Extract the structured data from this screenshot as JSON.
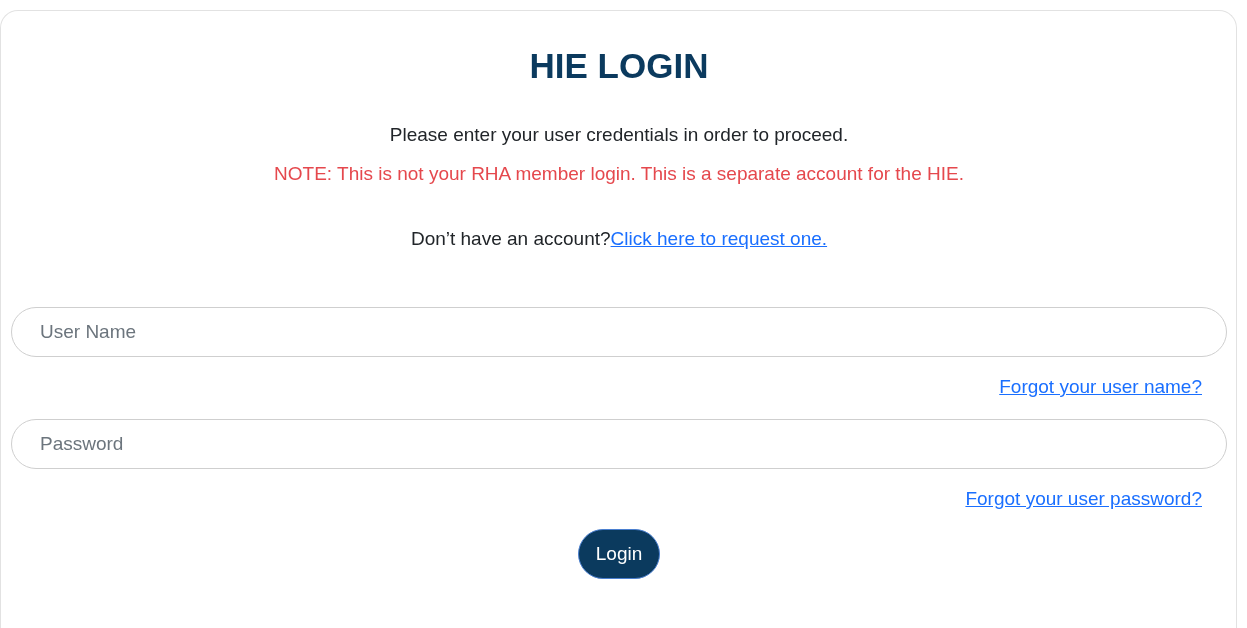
{
  "title": "HIE LOGIN",
  "instructions": "Please enter your user credentials in order to proceed.",
  "note": "NOTE: This is not your RHA member login. This is a separate account for the HIE.",
  "signup": {
    "prompt": "Don’t have an account?",
    "link": "Click here to request one."
  },
  "fields": [
    {
      "placeholder": "User Name",
      "help_link": "Forgot your user name?"
    },
    {
      "placeholder": "Password",
      "help_link": "Forgot your user password?"
    }
  ],
  "login_button": "Login"
}
